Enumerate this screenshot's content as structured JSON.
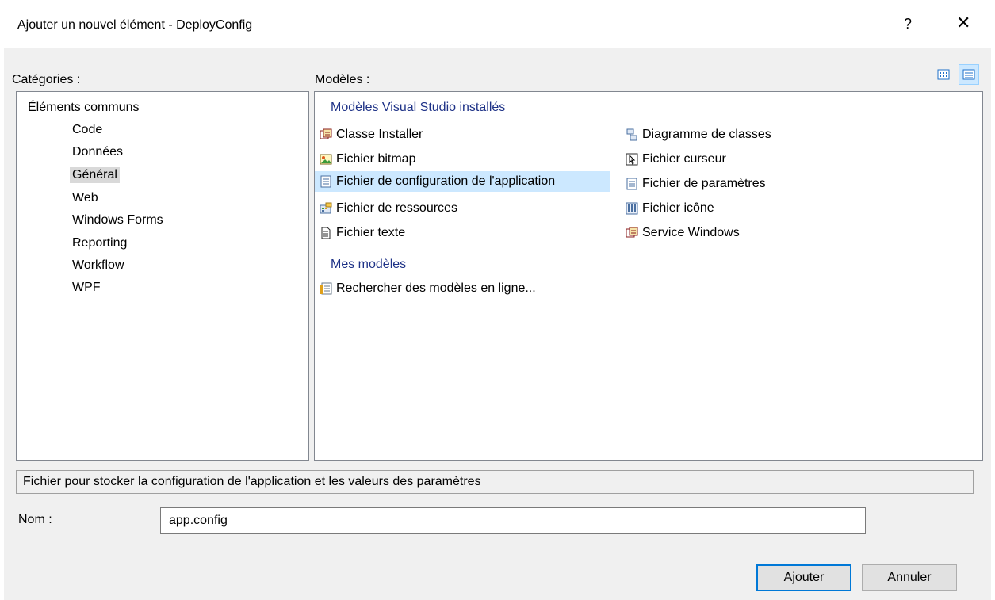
{
  "window": {
    "title": "Ajouter un nouvel élément - DeployConfig",
    "help": "?",
    "close": "✕"
  },
  "categories": {
    "label": "Catégories :",
    "items": [
      {
        "label": "Éléments communs",
        "level": 0
      },
      {
        "label": "Code",
        "level": 1
      },
      {
        "label": "Données",
        "level": 1
      },
      {
        "label": "Général",
        "level": 1,
        "selected": true
      },
      {
        "label": "Web",
        "level": 1
      },
      {
        "label": "Windows Forms",
        "level": 1
      },
      {
        "label": "Reporting",
        "level": 1
      },
      {
        "label": "Workflow",
        "level": 1
      },
      {
        "label": "WPF",
        "level": 1
      }
    ]
  },
  "templates": {
    "label": "Modèles :",
    "group_installed": "Modèles Visual Studio installés",
    "installed_left": [
      {
        "label": "Classe Installer",
        "icon": "installer-class-icon"
      },
      {
        "label": "Fichier bitmap",
        "icon": "bitmap-icon"
      },
      {
        "label": "Fichier de configuration de l'application",
        "icon": "config-file-icon",
        "selected": true
      },
      {
        "label": "Fichier de ressources",
        "icon": "resource-file-icon"
      },
      {
        "label": "Fichier texte",
        "icon": "text-file-icon"
      }
    ],
    "installed_right": [
      {
        "label": "Diagramme de classes",
        "icon": "class-diagram-icon"
      },
      {
        "label": "Fichier curseur",
        "icon": "cursor-file-icon"
      },
      {
        "label": "Fichier de paramètres",
        "icon": "settings-file-icon"
      },
      {
        "label": "Fichier icône",
        "icon": "icon-file-icon"
      },
      {
        "label": "Service Windows",
        "icon": "windows-service-icon"
      }
    ],
    "group_mine": "Mes modèles",
    "mine": [
      {
        "label": "Rechercher des modèles en ligne...",
        "icon": "search-online-icon"
      }
    ]
  },
  "description": "Fichier pour stocker la configuration de l'application et les valeurs des paramètres",
  "name_field": {
    "label": "Nom :",
    "value": "app.config"
  },
  "buttons": {
    "add": "Ajouter",
    "cancel": "Annuler"
  },
  "colors": {
    "selection": "#cce8ff",
    "group_text": "#1e3287",
    "accent": "#0078d7"
  }
}
